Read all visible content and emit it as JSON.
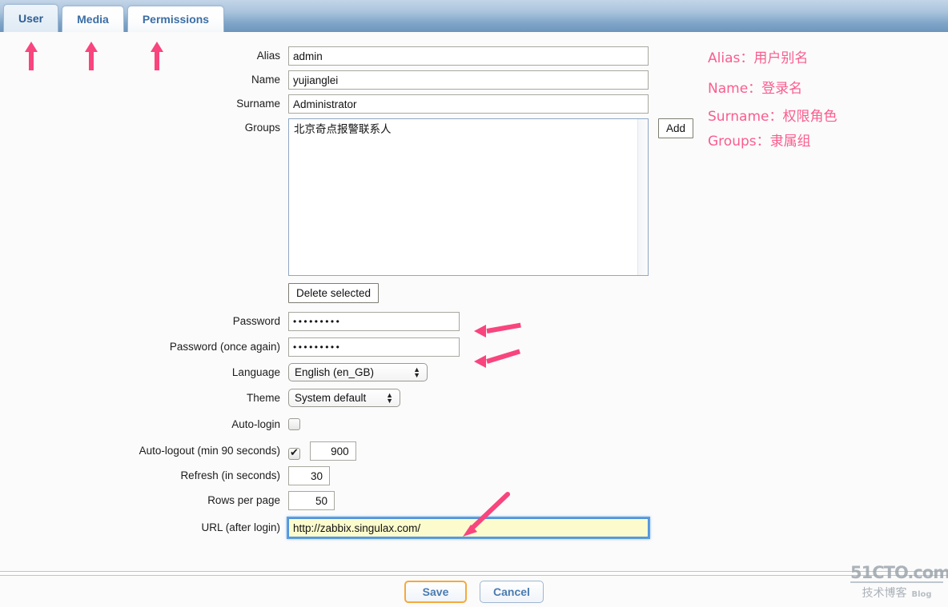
{
  "tabs": [
    {
      "label": "User",
      "active": true
    },
    {
      "label": "Media",
      "active": false
    },
    {
      "label": "Permissions",
      "active": false
    }
  ],
  "form": {
    "alias": {
      "label": "Alias",
      "value": "admin"
    },
    "name": {
      "label": "Name",
      "value": "yujianglei"
    },
    "surname": {
      "label": "Surname",
      "value": "Administrator"
    },
    "groups": {
      "label": "Groups",
      "value": "北京奇点报警联系人",
      "add_label": "Add",
      "delete_label": "Delete selected"
    },
    "password": {
      "label": "Password",
      "value": "•••••••••"
    },
    "password_again": {
      "label": "Password (once again)",
      "value": "•••••••••"
    },
    "language": {
      "label": "Language",
      "value": "English (en_GB)"
    },
    "theme": {
      "label": "Theme",
      "value": "System default"
    },
    "auto_login": {
      "label": "Auto-login",
      "checked": false
    },
    "auto_logout": {
      "label": "Auto-logout (min 90 seconds)",
      "checked": true,
      "value": "900"
    },
    "refresh": {
      "label": "Refresh (in seconds)",
      "value": "30"
    },
    "rows_per_page": {
      "label": "Rows per page",
      "value": "50"
    },
    "url_after_login": {
      "label": "URL (after login)",
      "value": "http://zabbix.singulax.com/"
    }
  },
  "footer": {
    "save_label": "Save",
    "cancel_label": "Cancel"
  },
  "annotations": {
    "color": "#fa5d8e",
    "notes": [
      {
        "text": "Alias：用户别名"
      },
      {
        "text": "Name：登录名"
      },
      {
        "text": "Surname：权限角色"
      },
      {
        "text": "Groups：隶属组"
      }
    ]
  },
  "watermark": {
    "site": "51CTO.com",
    "cn": "技术博客",
    "en": "Blog"
  }
}
